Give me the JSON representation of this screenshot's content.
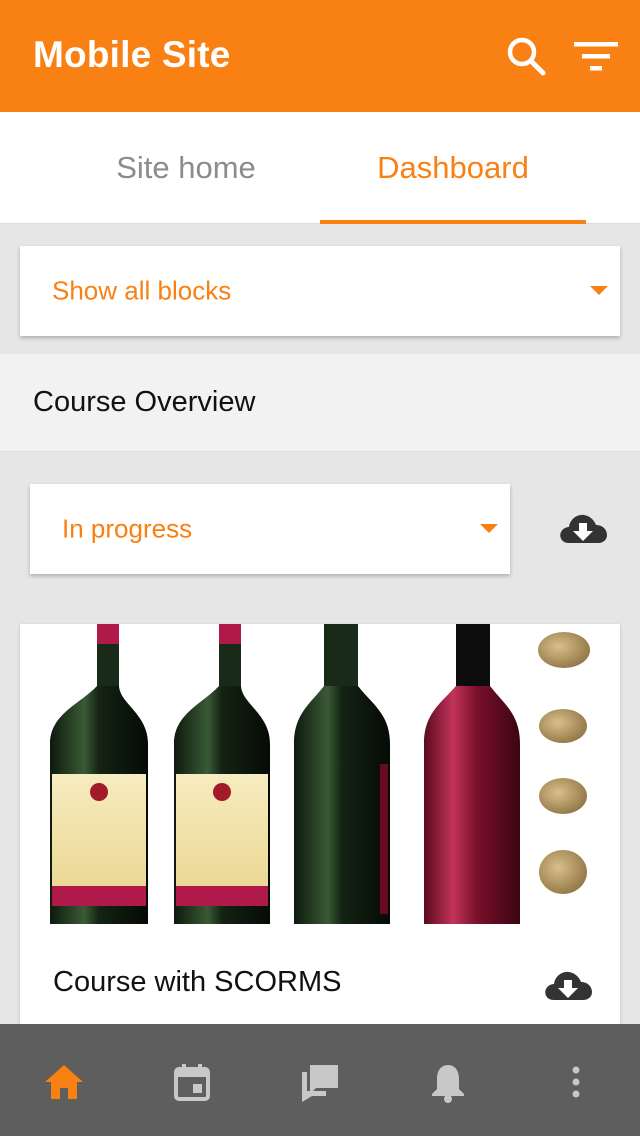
{
  "header": {
    "title": "Mobile Site"
  },
  "tabs": [
    {
      "label": "Site home",
      "active": false
    },
    {
      "label": "Dashboard",
      "active": true
    }
  ],
  "blocks_select": {
    "label": "Show all blocks"
  },
  "course_overview": {
    "title": "Course Overview",
    "filter": {
      "label": "In progress"
    }
  },
  "courses": [
    {
      "name": "Course with SCORMS"
    }
  ],
  "bottom_nav": [
    {
      "icon": "home-icon",
      "active": true
    },
    {
      "icon": "calendar-icon",
      "active": false
    },
    {
      "icon": "messages-icon",
      "active": false
    },
    {
      "icon": "notifications-icon",
      "active": false
    },
    {
      "icon": "more-icon",
      "active": false
    }
  ],
  "colors": {
    "accent": "#f98012",
    "nav_bg": "#5e5e5e",
    "icon_dark": "#333333",
    "nav_icon": "#c8c8c8"
  }
}
